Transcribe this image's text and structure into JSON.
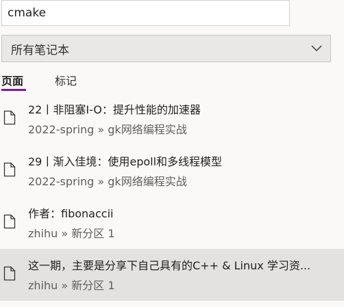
{
  "search": {
    "value": "cmake",
    "placeholder": ""
  },
  "notebook_filter": {
    "selected": "所有笔记本",
    "icon": "chevron-down-icon"
  },
  "tabs": [
    {
      "label": "页面",
      "active": true
    },
    {
      "label": "标记",
      "active": false
    }
  ],
  "colors": {
    "accent": "#7719aa",
    "selected_row": "#e3e2e1",
    "background": "#faf9f8"
  },
  "results": [
    {
      "title": "22丨非阻塞I-O：提升性能的加速器",
      "path": "2022-spring » gk网络编程实战",
      "icon": "page-icon",
      "selected": false
    },
    {
      "title": "29丨渐入佳境：使用epoll和多线程模型",
      "path": "2022-spring » gk网络编程实战",
      "icon": "page-icon",
      "selected": false
    },
    {
      "title": "作者：fibonaccii",
      "path": "zhihu » 新分区 1",
      "icon": "page-icon",
      "selected": false
    },
    {
      "title": "这一期，主要是分享下自己具有的C++ & Linux 学习资...",
      "path": "zhihu » 新分区 1",
      "icon": "page-icon",
      "selected": true
    }
  ]
}
